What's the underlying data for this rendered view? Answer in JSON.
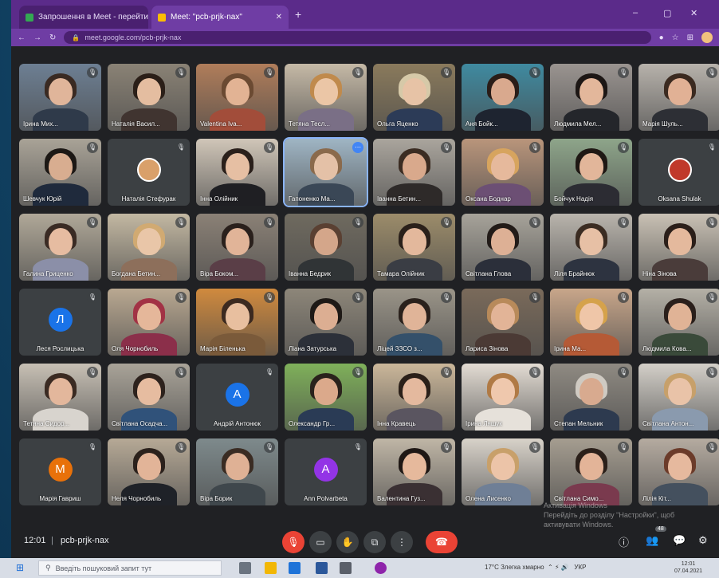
{
  "browser": {
    "tabs": [
      {
        "label": "Запрошення в Meet - перейти",
        "active": false
      },
      {
        "label": "Meet: \"pcb-prjk-nax\"",
        "active": true
      }
    ],
    "new_tab_icon": "plus-icon",
    "url": "meet.google.com/pcb-prjk-nax"
  },
  "tiles": [
    {
      "name": "Ірина Мих...",
      "kind": "video",
      "bg": "#6d7f93",
      "skin": "#e0b59a",
      "hair": "#3a2a22",
      "shirt": "#2f3a4a"
    },
    {
      "name": "Наталія Васил...",
      "kind": "video",
      "bg": "#8a8275",
      "skin": "#e4bda0",
      "hair": "#2b1f18",
      "shirt": "#403430"
    },
    {
      "name": "Valentina Iva...",
      "kind": "video",
      "bg": "#b07d5a",
      "skin": "#e2b394",
      "hair": "#6b4a32",
      "shirt": "#a24d3a"
    },
    {
      "name": "Тетяна Тесл...",
      "kind": "video",
      "bg": "#c5b9a6",
      "skin": "#ebc6a6",
      "hair": "#c08a4c",
      "shirt": "#7a6f86"
    },
    {
      "name": "Ольга Яценко",
      "kind": "video",
      "bg": "#8a7a5c",
      "skin": "#e7c3a6",
      "hair": "#d6c9a8",
      "shirt": "#2c3b57"
    },
    {
      "name": "Аня Бойк...",
      "kind": "video",
      "bg": "#3f8aa0",
      "skin": "#d9a98e",
      "hair": "#2a1d18",
      "shirt": "#1e2430"
    },
    {
      "name": "Людмила Мел...",
      "kind": "video",
      "bg": "#9a9490",
      "skin": "#e3b79b",
      "hair": "#1d1715",
      "shirt": "#24262b"
    },
    {
      "name": "Марія Шуль...",
      "kind": "video",
      "bg": "#b7b2ab",
      "skin": "#e1b195",
      "hair": "#3b2a20",
      "shirt": "#2d2f35"
    },
    {
      "name": "Шевчук Юрій",
      "kind": "video",
      "bg": "#a9a397",
      "skin": "#d8ad90",
      "hair": "#1c1815",
      "shirt": "#1f2a3c"
    },
    {
      "name": "Наталія Стефурак",
      "kind": "photo-avatar",
      "avatar_color": "#d9a06a"
    },
    {
      "name": "Інна Олійник",
      "kind": "video",
      "bg": "#d0c6b8",
      "skin": "#e6bfa3",
      "hair": "#2a201b",
      "shirt": "#1f1f23"
    },
    {
      "name": "Гапоненко Ма...",
      "kind": "video",
      "bg": "#9fb5c4",
      "skin": "#e4c1a7",
      "hair": "#8a6a4c",
      "shirt": "#3a4756",
      "active": true
    },
    {
      "name": "Іванна Бетин...",
      "kind": "video",
      "bg": "#aaa59d",
      "skin": "#d9a98c",
      "hair": "#3b2c22",
      "shirt": "#2e2a29"
    },
    {
      "name": "Оксана Боднар",
      "kind": "video",
      "bg": "#b9957b",
      "skin": "#e6b99c",
      "hair": "#d7a45e",
      "shirt": "#6c4f74"
    },
    {
      "name": "Бойчук Надія",
      "kind": "video",
      "bg": "#8ea58a",
      "skin": "#e2b69a",
      "hair": "#1f1814",
      "shirt": "#2c2c33"
    },
    {
      "name": "Oksana Shulak",
      "kind": "photo-avatar",
      "avatar_color": "#c0392b"
    },
    {
      "name": "Галина Гриценко",
      "kind": "video",
      "bg": "#b0a898",
      "skin": "#e6bca1",
      "hair": "#3a2b24",
      "shirt": "#8b8fa8"
    },
    {
      "name": "Богдана Бетин...",
      "kind": "video",
      "bg": "#c3b8a2",
      "skin": "#e9c6a8",
      "hair": "#d1aa72",
      "shirt": "#8d6f5b"
    },
    {
      "name": "Віра Боком...",
      "kind": "video",
      "bg": "#8b8176",
      "skin": "#e1b498",
      "hair": "#2a201c",
      "shirt": "#5a3e47"
    },
    {
      "name": "Іванна Бедрик",
      "kind": "video",
      "bg": "#6f6a5f",
      "skin": "#d4a68a",
      "hair": "#5a4032",
      "shirt": "#303436"
    },
    {
      "name": "Тамара Олійник",
      "kind": "video",
      "bg": "#9c8c6a",
      "skin": "#e3b89c",
      "hair": "#2a201a",
      "shirt": "#3a3d44"
    },
    {
      "name": "Світлана Глова",
      "kind": "video",
      "bg": "#a7a39a",
      "skin": "#ddb095",
      "hair": "#221b18",
      "shirt": "#2b2f3a"
    },
    {
      "name": "Ліля Брайнюк",
      "kind": "video",
      "bg": "#b9b4ac",
      "skin": "#e7c0a5",
      "hair": "#3b2c22",
      "shirt": "#2d3340"
    },
    {
      "name": "Ніна Зінова",
      "kind": "video",
      "bg": "#c9c1b4",
      "skin": "#e4b99d",
      "hair": "#2b1f1a",
      "shirt": "#4a3c3a"
    },
    {
      "name": "Леся Рослицька",
      "kind": "avatar",
      "letter": "Л",
      "avatar_color": "#1a73e8"
    },
    {
      "name": "Оля Чорнобиль",
      "kind": "video",
      "bg": "#b9a891",
      "skin": "#e5b79a",
      "hair": "#a23245",
      "shirt": "#8b2f4a"
    },
    {
      "name": "Марія Біленька",
      "kind": "video",
      "bg": "#d08a3e",
      "skin": "#e8bf9f",
      "hair": "#3c2a20",
      "shirt": "#7a5a3a"
    },
    {
      "name": "Ліана Затурська",
      "kind": "video",
      "bg": "#8d8679",
      "skin": "#dcae92",
      "hair": "#1e1916",
      "shirt": "#2c3039"
    },
    {
      "name": "Ліцей ЗЗСО з...",
      "kind": "video",
      "bg": "#9a9488",
      "skin": "#e0b498",
      "hair": "#2a211c",
      "shirt": "#34506a"
    },
    {
      "name": "Лариса Зінова",
      "kind": "video",
      "bg": "#7a6a5a",
      "skin": "#e2b497",
      "hair": "#b88a5a",
      "shirt": "#4b3a35"
    },
    {
      "name": "Ірина Ма...",
      "kind": "video",
      "bg": "#c8a68a",
      "skin": "#efc6a8",
      "hair": "#d5a24b",
      "shirt": "#b55a36"
    },
    {
      "name": "Людмила Кова...",
      "kind": "video",
      "bg": "#b4b0a6",
      "skin": "#e0b396",
      "hair": "#2a1f1b",
      "shirt": "#3a4a3a"
    },
    {
      "name": "Тетяна Сидор...",
      "kind": "video",
      "bg": "#c7c0b4",
      "skin": "#e3b79c",
      "hair": "#3a2a22",
      "shirt": "#d8d4ce"
    },
    {
      "name": "Світлана Осадча...",
      "kind": "video",
      "bg": "#a9a398",
      "skin": "#e6bca0",
      "hair": "#2d221d",
      "shirt": "#30527a"
    },
    {
      "name": "Андрій Антонюк",
      "kind": "avatar",
      "letter": "А",
      "avatar_color": "#1a73e8"
    },
    {
      "name": "Олександр Гр...",
      "kind": "video",
      "bg": "#7fb05a",
      "skin": "#dba98b",
      "hair": "#2a221c",
      "shirt": "#2a3b55"
    },
    {
      "name": "Інна Кравець",
      "kind": "video",
      "bg": "#cbb79a",
      "skin": "#e4b99e",
      "hair": "#2b2019",
      "shirt": "#5a5560"
    },
    {
      "name": "Ірина Ляшук",
      "kind": "video",
      "bg": "#e3dcd3",
      "skin": "#efc8ad",
      "hair": "#b07a45",
      "shirt": "#e6e1da"
    },
    {
      "name": "Степан Мельник",
      "kind": "video",
      "bg": "#8f8a82",
      "skin": "#d8aa8f",
      "hair": "#cfcac2",
      "shirt": "#2d3a4f"
    },
    {
      "name": "Світлана Антон...",
      "kind": "video",
      "bg": "#d3cfc8",
      "skin": "#e9c3a8",
      "hair": "#c7a06a",
      "shirt": "#8a9aae"
    },
    {
      "name": "Марія Гавриш",
      "kind": "avatar",
      "letter": "М",
      "avatar_color": "#e8710a"
    },
    {
      "name": "Неля Чорнобиль",
      "kind": "video",
      "bg": "#b6a996",
      "skin": "#e2b498",
      "hair": "#2b211c",
      "shirt": "#1f2228"
    },
    {
      "name": "Віра Борик",
      "kind": "video",
      "bg": "#7e8a8c",
      "skin": "#dfb195",
      "hair": "#3a2c23",
      "shirt": "#3f474c"
    },
    {
      "name": "Ann Polvarbeta",
      "kind": "avatar",
      "letter": "А",
      "avatar_color": "#9334e6"
    },
    {
      "name": "Валентина Гуз...",
      "kind": "video",
      "bg": "#c0b6a6",
      "skin": "#e6b99c",
      "hair": "#1f1815",
      "shirt": "#3a3033"
    },
    {
      "name": "Олена Лисенко",
      "kind": "video",
      "bg": "#d8d2c9",
      "skin": "#ecc4a8",
      "hair": "#c8a06a",
      "shirt": "#6f7f96"
    },
    {
      "name": "Світлана Симо...",
      "kind": "video",
      "bg": "#a59d90",
      "skin": "#e3b498",
      "hair": "#2b201a",
      "shirt": "#7a3a4e"
    },
    {
      "name": "Лілія Кіт...",
      "kind": "video",
      "bg": "#b5aba0",
      "skin": "#e6b99e",
      "hair": "#6b3b2a",
      "shirt": "#44505e"
    }
  ],
  "bottom": {
    "time": "12:01",
    "separator": "|",
    "meeting_code": "pcb-prjk-nax",
    "people_count": "48"
  },
  "activation": {
    "title": "Активація Windows",
    "body": "Перейдіть до розділу \"Настройки\", щоб активувати Windows."
  },
  "taskbar": {
    "search_placeholder": "Введіть пошуковий запит тут",
    "tray_text": "17°C Злегка хмарно",
    "lang": "УКР",
    "time": "12:01",
    "date": "07.04.2021"
  }
}
